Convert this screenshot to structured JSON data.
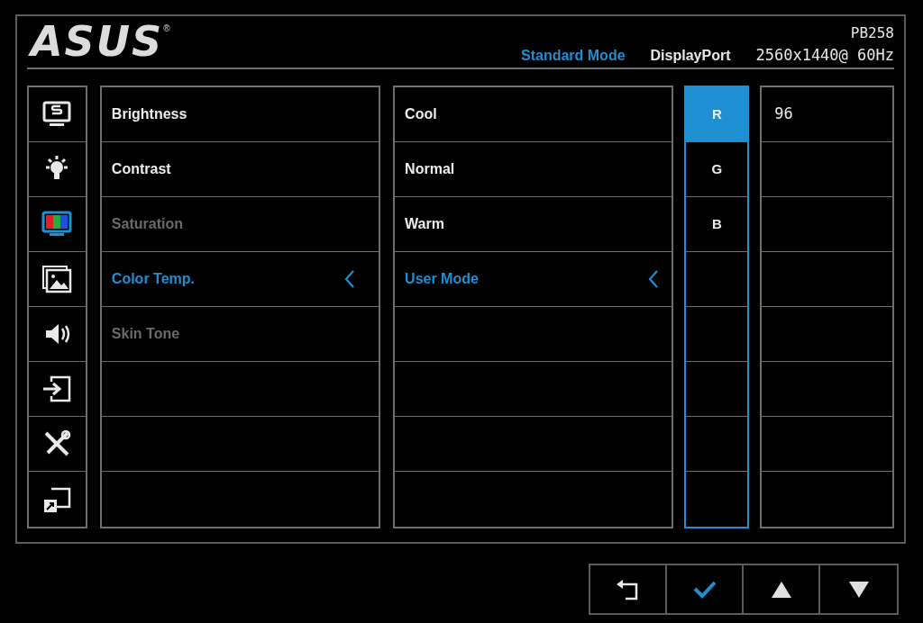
{
  "header": {
    "logo": "ASUS",
    "logo_mark": "®",
    "model": "PB258",
    "mode": "Standard Mode",
    "input": "DisplayPort",
    "resolution": "2560x1440@ 60Hz"
  },
  "sidebar": {
    "items": [
      {
        "selected": false
      },
      {
        "selected": false
      },
      {
        "selected": true
      },
      {
        "selected": false
      },
      {
        "selected": false
      },
      {
        "selected": false
      },
      {
        "selected": false
      },
      {
        "selected": false
      }
    ]
  },
  "menu": {
    "items": [
      {
        "label": "Brightness",
        "disabled": false,
        "selected": false
      },
      {
        "label": "Contrast",
        "disabled": false,
        "selected": false
      },
      {
        "label": "Saturation",
        "disabled": true,
        "selected": false
      },
      {
        "label": "Color Temp.",
        "disabled": false,
        "selected": true
      },
      {
        "label": "Skin Tone",
        "disabled": true,
        "selected": false
      }
    ]
  },
  "options": {
    "items": [
      {
        "label": "Cool",
        "selected": false
      },
      {
        "label": "Normal",
        "selected": false
      },
      {
        "label": "Warm",
        "selected": false
      },
      {
        "label": "User Mode",
        "selected": true
      }
    ]
  },
  "channels": {
    "items": [
      {
        "label": "R",
        "selected": true
      },
      {
        "label": "G",
        "selected": false
      },
      {
        "label": "B",
        "selected": false
      }
    ]
  },
  "values": {
    "items": [
      "96"
    ]
  }
}
